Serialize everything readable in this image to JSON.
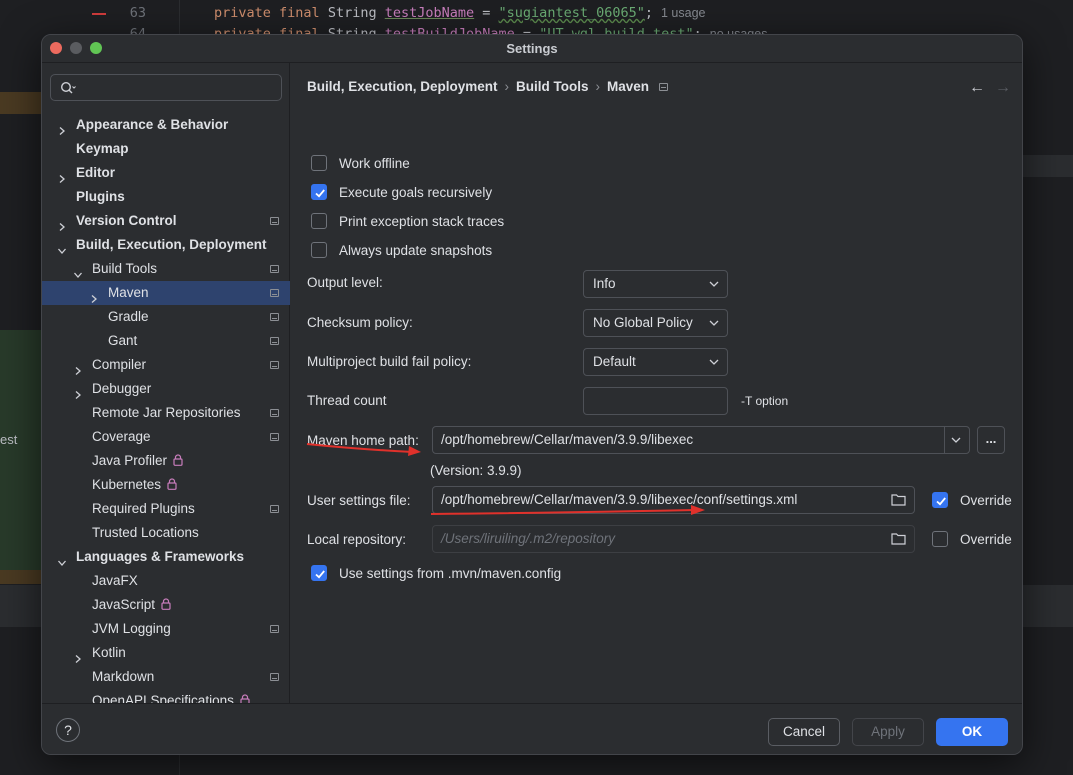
{
  "editor": {
    "lines": [
      {
        "num": "63",
        "kw1": "private",
        "kw2": "final",
        "type": "String",
        "field": "testJobName",
        "eq": " = ",
        "str": "\"sugiantest_06065\"",
        "end": ";",
        "hint": "1 usage"
      },
      {
        "num": "64",
        "kw1": "private",
        "kw2": "final",
        "type": "String",
        "field": "testBuildJobName",
        "eq": " = ",
        "str": "\"UT_wgl_build_test\"",
        "end": ";",
        "hint": "no usages"
      }
    ],
    "side_text": "est"
  },
  "dialog": {
    "title": "Settings",
    "search": {
      "placeholder": ""
    },
    "tree": [
      {
        "label": "Appearance & Behavior",
        "bold": true,
        "chevron": "right",
        "level": 0,
        "pm": false
      },
      {
        "label": "Keymap",
        "bold": true,
        "chevron": "none",
        "level": 0,
        "pm": false
      },
      {
        "label": "Editor",
        "bold": true,
        "chevron": "right",
        "level": 0,
        "pm": false
      },
      {
        "label": "Plugins",
        "bold": true,
        "chevron": "none",
        "level": 0,
        "pm": false
      },
      {
        "label": "Version Control",
        "bold": true,
        "chevron": "right",
        "level": 0,
        "pm": true
      },
      {
        "label": "Build, Execution, Deployment",
        "bold": true,
        "chevron": "down",
        "level": 0,
        "pm": false
      },
      {
        "label": "Build Tools",
        "bold": false,
        "chevron": "down",
        "level": 1,
        "pm": true
      },
      {
        "label": "Maven",
        "bold": false,
        "chevron": "right",
        "level": 2,
        "pm": true,
        "selected": true
      },
      {
        "label": "Gradle",
        "bold": false,
        "chevron": "none",
        "level": 2,
        "pm": true
      },
      {
        "label": "Gant",
        "bold": false,
        "chevron": "none",
        "level": 2,
        "pm": true
      },
      {
        "label": "Compiler",
        "bold": false,
        "chevron": "right",
        "level": 1,
        "pm": true
      },
      {
        "label": "Debugger",
        "bold": false,
        "chevron": "right",
        "level": 1,
        "pm": false
      },
      {
        "label": "Remote Jar Repositories",
        "bold": false,
        "chevron": "none",
        "level": 1,
        "pm": true
      },
      {
        "label": "Coverage",
        "bold": false,
        "chevron": "none",
        "level": 1,
        "pm": true
      },
      {
        "label": "Java Profiler",
        "bold": false,
        "chevron": "none",
        "level": 1,
        "pm": false,
        "lock": true
      },
      {
        "label": "Kubernetes",
        "bold": false,
        "chevron": "none",
        "level": 1,
        "pm": false,
        "lock": true
      },
      {
        "label": "Required Plugins",
        "bold": false,
        "chevron": "none",
        "level": 1,
        "pm": true
      },
      {
        "label": "Trusted Locations",
        "bold": false,
        "chevron": "none",
        "level": 1,
        "pm": false
      },
      {
        "label": "Languages & Frameworks",
        "bold": true,
        "chevron": "down",
        "level": 0,
        "pm": false
      },
      {
        "label": "JavaFX",
        "bold": false,
        "chevron": "none",
        "level": 1,
        "pm": false
      },
      {
        "label": "JavaScript",
        "bold": false,
        "chevron": "none",
        "level": 1,
        "pm": false,
        "lock": true
      },
      {
        "label": "JVM Logging",
        "bold": false,
        "chevron": "none",
        "level": 1,
        "pm": true
      },
      {
        "label": "Kotlin",
        "bold": false,
        "chevron": "right",
        "level": 1,
        "pm": false
      },
      {
        "label": "Markdown",
        "bold": false,
        "chevron": "none",
        "level": 1,
        "pm": true
      },
      {
        "label": "OpenAPI Specifications",
        "bold": false,
        "chevron": "none",
        "level": 1,
        "pm": false,
        "lock": true
      }
    ],
    "breadcrumb": [
      "Build, Execution, Deployment",
      "Build Tools",
      "Maven"
    ],
    "checkboxes": {
      "work_offline": {
        "label": "Work offline",
        "checked": false
      },
      "execute_recursively": {
        "label": "Execute goals recursively",
        "checked": true
      },
      "print_stack": {
        "label": "Print exception stack traces",
        "checked": false
      },
      "always_update": {
        "label": "Always update snapshots",
        "checked": false
      },
      "use_mvn_config": {
        "label": "Use settings from .mvn/maven.config",
        "checked": true
      }
    },
    "fields": {
      "output_level": {
        "label": "Output level:",
        "value": "Info"
      },
      "checksum_policy": {
        "label": "Checksum policy:",
        "value": "No Global Policy"
      },
      "fail_policy": {
        "label": "Multiproject build fail policy:",
        "value": "Default"
      },
      "thread_count": {
        "label": "Thread count",
        "value": "",
        "suffix": "-T option"
      },
      "maven_home": {
        "label": "Maven home path:",
        "value": "/opt/homebrew/Cellar/maven/3.9.9/libexec",
        "version": "(Version: 3.9.9)",
        "browse": "..."
      },
      "user_settings": {
        "label": "User settings file:",
        "value": "/opt/homebrew/Cellar/maven/3.9.9/libexec/conf/settings.xml",
        "override_label": "Override",
        "override_checked": true
      },
      "local_repo": {
        "label": "Local repository:",
        "value": "/Users/liruiling/.m2/repository",
        "override_label": "Override",
        "override_checked": false
      }
    },
    "buttons": {
      "help": "?",
      "cancel": "Cancel",
      "apply": "Apply",
      "ok": "OK"
    },
    "colors": {
      "accent": "#3574f0",
      "selection": "#2e436e",
      "annotation_arrow": "#e0312b"
    }
  }
}
